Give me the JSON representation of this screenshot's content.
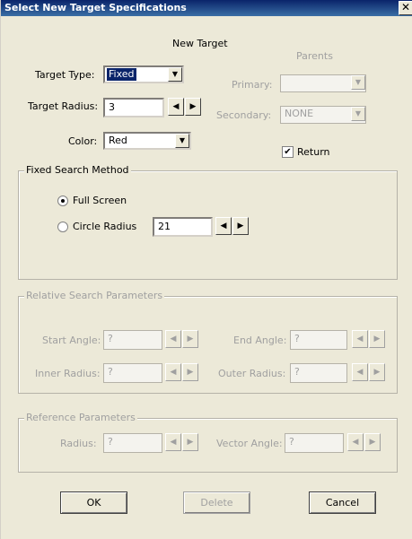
{
  "window": {
    "title": "Select New Target Specifications",
    "close_glyph": "✕"
  },
  "header": {
    "new_target": "New Target",
    "parents": "Parents"
  },
  "target_type": {
    "label": "Target Type:",
    "value": "Fixed"
  },
  "target_radius": {
    "label": "Target Radius:",
    "value": "3"
  },
  "color": {
    "label": "Color:",
    "value": "Red"
  },
  "primary": {
    "label": "Primary:",
    "value": ""
  },
  "secondary": {
    "label": "Secondary:",
    "value": "NONE"
  },
  "return": {
    "label": "Return",
    "checked": true
  },
  "fixed_search": {
    "title": "Fixed Search Method",
    "full_screen": "Full Screen",
    "circle_radius": "Circle Radius",
    "circle_radius_value": "21",
    "selected": "Full Screen"
  },
  "relative_search": {
    "title": "Relative Search Parameters",
    "start_angle_label": "Start Angle:",
    "start_angle_value": "?",
    "end_angle_label": "End Angle:",
    "end_angle_value": "?",
    "inner_radius_label": "Inner Radius:",
    "inner_radius_value": "?",
    "outer_radius_label": "Outer Radius:",
    "outer_radius_value": "?"
  },
  "reference": {
    "title": "Reference Parameters",
    "radius_label": "Radius:",
    "radius_value": "?",
    "vector_angle_label": "Vector Angle:",
    "vector_angle_value": "?"
  },
  "buttons": {
    "ok": "OK",
    "delete": "Delete",
    "cancel": "Cancel"
  },
  "glyphs": {
    "dropdown": "▼",
    "left": "◀",
    "right": "▶",
    "check": "✔"
  }
}
